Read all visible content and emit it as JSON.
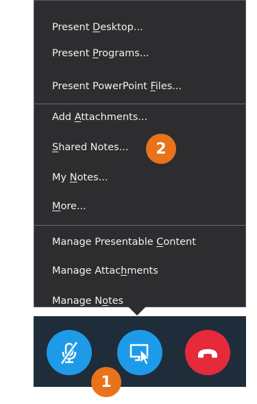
{
  "menu": {
    "items": [
      {
        "pre": "Present ",
        "u": "D",
        "post": "esktop..."
      },
      {
        "pre": "Present ",
        "u": "P",
        "post": "rograms..."
      },
      {
        "pre": "Present PowerPoint ",
        "u": "F",
        "post": "iles..."
      },
      {
        "pre": "Add ",
        "u": "A",
        "post": "ttachments..."
      },
      {
        "pre": "",
        "u": "S",
        "post": "hared Notes..."
      },
      {
        "pre": "My ",
        "u": "N",
        "post": "otes..."
      },
      {
        "pre": "",
        "u": "M",
        "post": "ore..."
      },
      {
        "pre": "Manage Presentable ",
        "u": "C",
        "post": "ontent"
      },
      {
        "pre": "Manage Attac",
        "u": "h",
        "post": "ments"
      },
      {
        "pre": "Manage N",
        "u": "o",
        "post": "tes"
      }
    ]
  },
  "toolbar": {
    "mic_icon": "muted-microphone-icon",
    "present_icon": "present-screen-icon",
    "hangup_icon": "hang-up-phone-icon"
  },
  "badges": {
    "badge_1": "1",
    "badge_2": "2",
    "color": "#e8731a"
  },
  "colors": {
    "menu_bg": "#2d2d30",
    "toolbar_bg": "#1f2c3a",
    "accent_blue": "#1e9be8",
    "hangup_red": "#e52a3b"
  }
}
